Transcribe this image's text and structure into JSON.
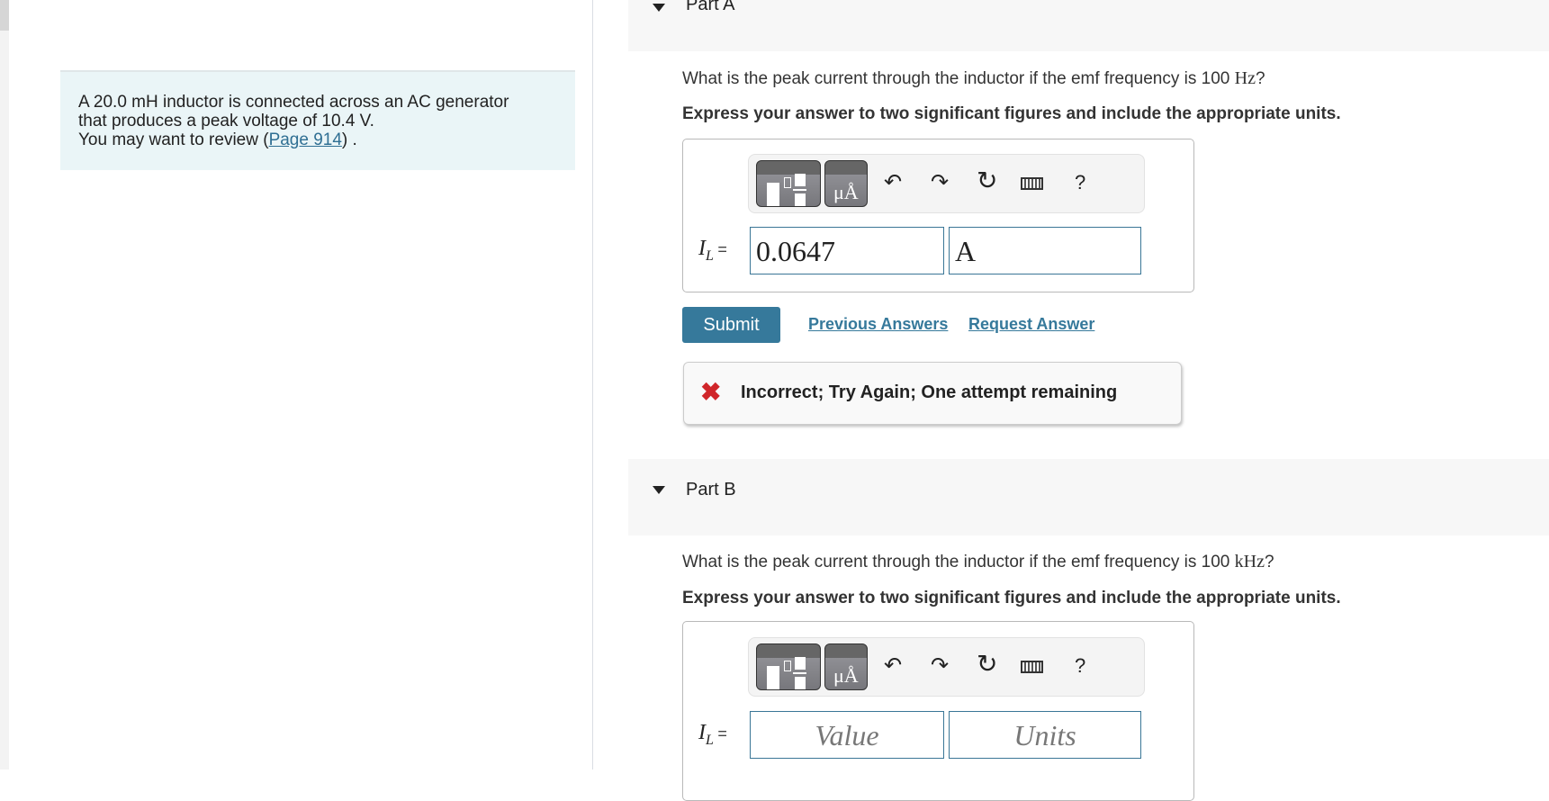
{
  "intro": {
    "line1": "A 20.0 mH inductor is connected across an AC generator",
    "line2": "that produces a peak voltage of 10.4 V.",
    "review_prefix": "You may want to review (",
    "review_link": "Page 914",
    "review_suffix": ") ."
  },
  "part_a": {
    "title": "Part A",
    "question": "What is the peak current through the inductor if the emf frequency is 100 ",
    "question_unit": "Hz",
    "question_end": "?",
    "instruction": "Express your answer to two significant figures and include the appropriate units.",
    "label_var": "I",
    "label_sub": "L",
    "equals": "=",
    "value": "0.0647",
    "units": "A",
    "submit_label": "Submit",
    "previous_answers": "Previous Answers",
    "request_answer": "Request Answer",
    "feedback": "Incorrect; Try Again; One attempt remaining",
    "feedback_color": "#d0262a"
  },
  "part_b": {
    "title": "Part B",
    "question": "What is the peak current through the inductor if the emf frequency is 100 ",
    "question_unit": "kHz",
    "question_end": "?",
    "instruction": "Express your answer to two significant figures and include the appropriate units.",
    "label_var": "I",
    "label_sub": "L",
    "equals": "=",
    "value_placeholder": "Value",
    "units_placeholder": "Units"
  },
  "toolbar": {
    "templates_icon": "fraction-templates-icon",
    "symbols_icon": "units-symbols-icon",
    "symbols_text": "μÅ",
    "undo_icon": "undo-icon",
    "redo_icon": "redo-icon",
    "reset_icon": "reset-icon",
    "keyboard_icon": "keyboard-icon",
    "help_text": "?"
  },
  "colors": {
    "accent": "#36799b",
    "intro_bg": "#eaf5f7",
    "part_header_bg": "#f7f7f7"
  }
}
